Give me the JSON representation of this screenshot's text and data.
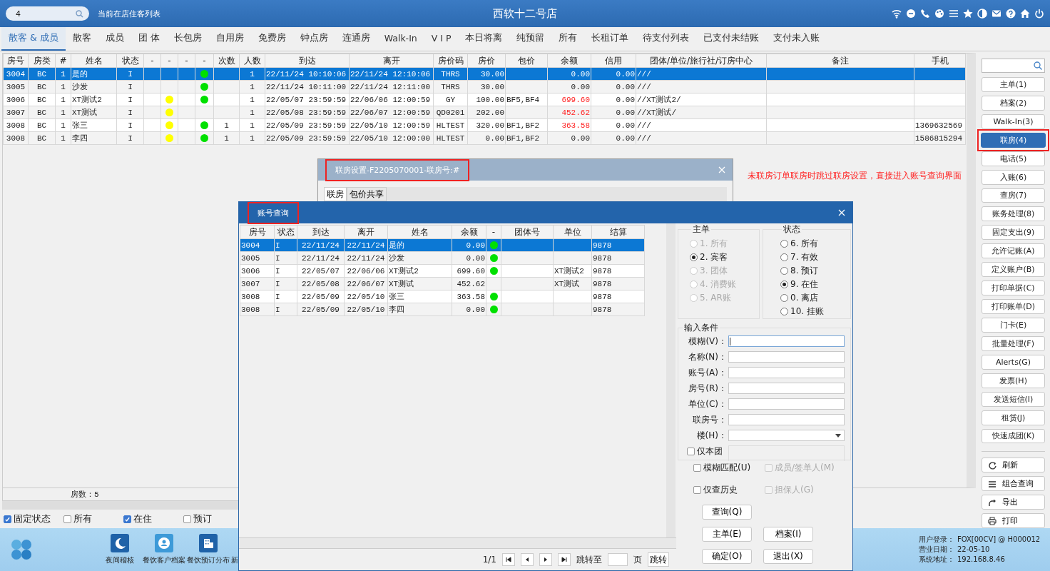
{
  "window": {
    "search_value": "4",
    "subtitle": "当前在店住客列表",
    "title": "西软十二号店"
  },
  "tabs": [
    {
      "label": "散客 & 成员",
      "selected": true
    },
    {
      "label": "散客",
      "selected": false
    },
    {
      "label": "成员",
      "selected": false
    },
    {
      "label": "团 体",
      "selected": false
    },
    {
      "label": "长包房",
      "selected": false
    },
    {
      "label": "自用房",
      "selected": false
    },
    {
      "label": "免费房",
      "selected": false
    },
    {
      "label": "钟点房",
      "selected": false
    },
    {
      "label": "连通房",
      "selected": false
    },
    {
      "label": "Walk-In",
      "selected": false
    },
    {
      "label": "V I P",
      "selected": false
    },
    {
      "label": "本日将离",
      "selected": false
    },
    {
      "label": "纯预留",
      "selected": false
    },
    {
      "label": "所有",
      "selected": false
    },
    {
      "label": "长租订单",
      "selected": false
    },
    {
      "label": "待支付列表",
      "selected": false
    },
    {
      "label": "已支付未结账",
      "selected": false
    },
    {
      "label": "支付未入账",
      "selected": false
    }
  ],
  "guest_table": {
    "columns": [
      "房号",
      "房类",
      "#",
      "姓名",
      "状态",
      "-",
      "-",
      "-",
      "-",
      "次数",
      "人数",
      "到达",
      "离开",
      "房价码",
      "房价",
      "包价",
      "余额",
      "信用",
      "团体/单位/旅行社/订房中心",
      "备注",
      "手机"
    ],
    "rows": [
      {
        "selected": true,
        "cells": [
          "3004",
          "BC",
          "1",
          "是的",
          "I",
          null,
          null,
          null,
          {
            "kind": "dot",
            "color": "#00e000"
          },
          null,
          "1",
          "22/11/24 10:10:06",
          "22/11/24 12:10:06",
          "THRS",
          "30.00",
          null,
          "0.00",
          "0.00",
          "///",
          null,
          null
        ]
      },
      {
        "selected": false,
        "cells": [
          "3005",
          "BC",
          "1",
          "沙发",
          "I",
          null,
          null,
          null,
          {
            "kind": "dot",
            "color": "#00e000"
          },
          null,
          "1",
          "22/11/24 10:11:00",
          "22/11/24 12:11:00",
          "THRS",
          "30.00",
          null,
          "0.00",
          "0.00",
          "///",
          null,
          null
        ]
      },
      {
        "selected": false,
        "cells": [
          "3006",
          "BC",
          "1",
          "XT测试2",
          "I",
          null,
          {
            "kind": "dot",
            "color": "#ffff00"
          },
          null,
          {
            "kind": "dot",
            "color": "#00e000"
          },
          null,
          "1",
          "22/05/07 23:59:59",
          "22/06/06 12:00:59",
          "GY",
          "100.00",
          "BF5,BF4",
          {
            "kind": "alert",
            "text": "699.60"
          },
          "0.00",
          "//XT测试2/",
          null,
          null
        ]
      },
      {
        "selected": false,
        "cells": [
          "3007",
          "BC",
          "1",
          "XT测试",
          "I",
          null,
          {
            "kind": "dot",
            "color": "#ffff00"
          },
          null,
          null,
          null,
          "1",
          "22/05/08 23:59:59",
          "22/06/07 12:00:59",
          "QD0201",
          "202.00",
          null,
          {
            "kind": "alert",
            "text": "452.62"
          },
          "0.00",
          "//XT测试/",
          null,
          null
        ]
      },
      {
        "selected": false,
        "cells": [
          "3008",
          "BC",
          "1",
          "张三",
          "I",
          null,
          {
            "kind": "dot",
            "color": "#ffff00"
          },
          null,
          {
            "kind": "dot",
            "color": "#00e000"
          },
          "1",
          "1",
          "22/05/09 23:59:59",
          "22/05/10 12:00:59",
          "HLTEST",
          "320.00",
          "BF1,BF2",
          {
            "kind": "alert",
            "text": "363.58"
          },
          "0.00",
          "///",
          null,
          "1369632569"
        ]
      },
      {
        "selected": false,
        "cells": [
          "3008",
          "BC",
          "1",
          "李四",
          "I",
          null,
          {
            "kind": "dot",
            "color": "#ffff00"
          },
          null,
          {
            "kind": "dot",
            "color": "#00e000"
          },
          "1",
          "1",
          "22/05/09 23:59:59",
          "22/05/10 12:00:00",
          "HLTEST",
          "0.00",
          "BF1,BF2",
          "0.00",
          "0.00",
          "///",
          null,
          "1586815294"
        ]
      }
    ]
  },
  "room_count": "房数：5",
  "filters": [
    {
      "label": "固定状态",
      "checked": true
    },
    {
      "label": "所有",
      "checked": false
    },
    {
      "label": "在住",
      "checked": true
    },
    {
      "label": "预订",
      "checked": false
    }
  ],
  "sidebar": {
    "buttons": [
      {
        "label": "主单(1)",
        "selected": false,
        "annotated": false
      },
      {
        "label": "档案(2)",
        "selected": false,
        "annotated": false
      },
      {
        "label": "Walk-In(3)",
        "selected": false,
        "annotated": false
      },
      {
        "label": "联房(4)",
        "selected": true,
        "annotated": true
      },
      {
        "label": "电话(5)",
        "selected": false,
        "annotated": false
      },
      {
        "label": "入账(6)",
        "selected": false,
        "annotated": false
      },
      {
        "label": "查房(7)",
        "selected": false,
        "annotated": false
      },
      {
        "label": "账务处理(8)",
        "selected": false,
        "annotated": false
      },
      {
        "label": "固定支出(9)",
        "selected": false,
        "annotated": false
      },
      {
        "label": "允许记账(A)",
        "selected": false,
        "annotated": false
      },
      {
        "label": "定义账户(B)",
        "selected": false,
        "annotated": false
      },
      {
        "label": "打印单据(C)",
        "selected": false,
        "annotated": false
      },
      {
        "label": "打印账单(D)",
        "selected": false,
        "annotated": false
      },
      {
        "label": "门卡(E)",
        "selected": false,
        "annotated": false
      },
      {
        "label": "批量处理(F)",
        "selected": false,
        "annotated": false
      },
      {
        "label": "Alerts(G)",
        "selected": false,
        "annotated": false
      },
      {
        "label": "发票(H)",
        "selected": false,
        "annotated": false
      },
      {
        "label": "发送短信(I)",
        "selected": false,
        "annotated": false
      },
      {
        "label": "租赁(J)",
        "selected": false,
        "annotated": false
      },
      {
        "label": "快速成团(K)",
        "selected": false,
        "annotated": false
      }
    ],
    "actions": [
      {
        "label": "刷新",
        "kind": "refresh"
      },
      {
        "label": "组合查询",
        "kind": "list"
      },
      {
        "label": "导出",
        "kind": "export"
      },
      {
        "label": "打印",
        "kind": "print"
      }
    ]
  },
  "note": "未联房订单联房时跳过联房设置，直接进入账号查询界面",
  "bottom_bar": {
    "apps": [
      {
        "label": "夜间稽核",
        "kind": "moon"
      },
      {
        "label": "餐饮客户档案",
        "kind": "person"
      },
      {
        "label": "餐饮预订分布",
        "kind": "building"
      },
      {
        "label": "新",
        "kind": "cut"
      }
    ],
    "status": [
      {
        "label": "用户登录：",
        "value": "FOX[00CV] @ H000012"
      },
      {
        "label": "营业日期：",
        "value": "22-05-10"
      },
      {
        "label": "系统地址：",
        "value": "192.168.8.46"
      }
    ]
  },
  "link_dialog": {
    "title": "联房设置-F2205070001-联房号:#",
    "annotated": true,
    "tabs": [
      {
        "label": "联房",
        "selected": true
      },
      {
        "label": "包价共享",
        "selected": false
      }
    ]
  },
  "account_dialog": {
    "title": "账号查询",
    "annotated": true,
    "table": {
      "columns": [
        "房号",
        "状态",
        "到达",
        "离开",
        "姓名",
        "余额",
        "-",
        "团体号",
        "单位",
        "结算"
      ],
      "rows": [
        {
          "selected": true,
          "cells": [
            "3004",
            "I",
            "22/11/24",
            "22/11/24",
            "是的",
            "0.00",
            {
              "kind": "dot",
              "color": "#00e000"
            },
            null,
            null,
            "9878"
          ]
        },
        {
          "selected": false,
          "cells": [
            "3005",
            "I",
            "22/11/24",
            "22/11/24",
            "沙发",
            "0.00",
            {
              "kind": "dot",
              "color": "#00e000"
            },
            null,
            null,
            "9878"
          ]
        },
        {
          "selected": false,
          "cells": [
            "3006",
            "I",
            "22/05/07",
            "22/06/06",
            "XT测试2",
            "699.60",
            {
              "kind": "dot",
              "color": "#00e000"
            },
            null,
            "XT测试2",
            "9878"
          ]
        },
        {
          "selected": false,
          "cells": [
            "3007",
            "I",
            "22/05/08",
            "22/06/07",
            "XT测试",
            "452.62",
            null,
            null,
            "XT测试",
            "9878"
          ]
        },
        {
          "selected": false,
          "cells": [
            "3008",
            "I",
            "22/05/09",
            "22/05/10",
            "张三",
            "363.58",
            {
              "kind": "dot",
              "color": "#00e000"
            },
            null,
            null,
            "9878"
          ]
        },
        {
          "selected": false,
          "cells": [
            "3008",
            "I",
            "22/05/09",
            "22/05/10",
            "李四",
            "0.00",
            {
              "kind": "dot",
              "color": "#00e000"
            },
            null,
            null,
            "9878"
          ]
        }
      ]
    },
    "master_group": {
      "title": "主单",
      "options": [
        {
          "label": "1. 所有",
          "selected": false,
          "disabled": true
        },
        {
          "label": "2. 宾客",
          "selected": true,
          "disabled": false
        },
        {
          "label": "3. 团体",
          "selected": false,
          "disabled": true
        },
        {
          "label": "4. 消费账",
          "selected": false,
          "disabled": true
        },
        {
          "label": "5. AR账",
          "selected": false,
          "disabled": true
        }
      ]
    },
    "status_group": {
      "title": "状态",
      "options": [
        {
          "label": "6. 所有",
          "selected": false,
          "disabled": false
        },
        {
          "label": "7. 有效",
          "selected": false,
          "disabled": false
        },
        {
          "label": "8. 预订",
          "selected": false,
          "disabled": false
        },
        {
          "label": "9. 在住",
          "selected": true,
          "disabled": false
        },
        {
          "label": "0. 离店",
          "selected": false,
          "disabled": false
        },
        {
          "label": "10. 挂账",
          "selected": false,
          "disabled": false
        }
      ]
    },
    "criteria": {
      "title": "输入条件",
      "fields": [
        {
          "label": "模糊(V)：",
          "kind": "text",
          "focused": true
        },
        {
          "label": "名称(N)：",
          "kind": "text",
          "focused": false
        },
        {
          "label": "账号(A)：",
          "kind": "text",
          "focused": false
        },
        {
          "label": "房号(R)：",
          "kind": "text",
          "focused": false
        },
        {
          "label": "单位(C)：",
          "kind": "text",
          "focused": false
        },
        {
          "label": "联房号：",
          "kind": "text",
          "focused": false
        },
        {
          "label": "楼(H)：",
          "kind": "select",
          "focused": false
        }
      ],
      "group_only": {
        "label": "仅本团",
        "checked": false
      },
      "options": [
        {
          "label": "模糊匹配(U)",
          "checked": false,
          "disabled": false
        },
        {
          "label": "成员/签单人(M)",
          "checked": false,
          "disabled": true
        },
        {
          "label": "仅查历史",
          "checked": false,
          "disabled": false
        },
        {
          "label": "担保人(G)",
          "checked": false,
          "disabled": true
        }
      ]
    },
    "buttons": [
      "查询(Q)",
      "主单(E)",
      "档案(I)",
      "确定(O)",
      "退出(X)"
    ],
    "pager": {
      "page": "1/1",
      "jump_label": "跳转至",
      "unit": "页",
      "jump_button": "跳转"
    }
  }
}
